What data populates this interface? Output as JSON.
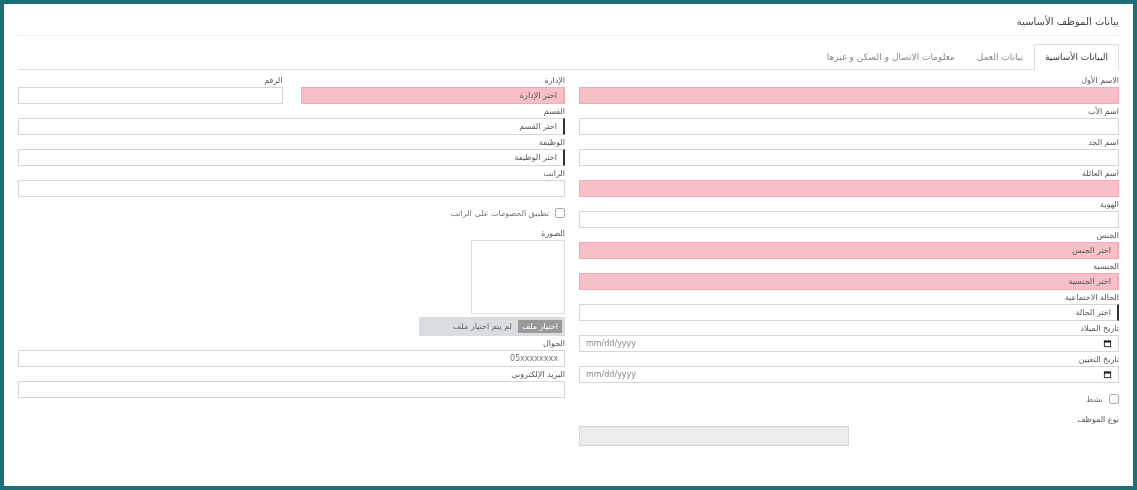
{
  "title": "بيانات الموظف الأساسية",
  "tabs": [
    {
      "label": "البيانات الأساسية",
      "selected": true
    },
    {
      "label": "بيانات العمل",
      "selected": false
    },
    {
      "label": "معلومات الاتصال و السكن و غيرها",
      "selected": false
    }
  ],
  "right_column": [
    {
      "kind": "text",
      "label": "الاسم الأول",
      "invalid": true
    },
    {
      "kind": "text",
      "label": "اسم الأب",
      "invalid": false
    },
    {
      "kind": "text",
      "label": "اسم الجد",
      "invalid": false
    },
    {
      "kind": "text",
      "label": "اسم العائلة",
      "invalid": true
    },
    {
      "kind": "text",
      "label": "الهوية",
      "invalid": false
    },
    {
      "kind": "select",
      "label": "الجنس",
      "value": "اختر الجنس",
      "invalid": true
    },
    {
      "kind": "select",
      "label": "الجنسية",
      "value": "اختر الجنسية",
      "invalid": true
    },
    {
      "kind": "select",
      "label": "الحالة الاجتماعية",
      "value": "اختر الحالة",
      "invalid": false
    },
    {
      "kind": "date",
      "label": "تاريخ الميلاد",
      "placeholder": "mm/dd/yyyy",
      "invalid": false
    },
    {
      "kind": "date",
      "label": "تاريخ التعيين",
      "placeholder": "mm/dd/yyyy",
      "invalid": false
    },
    {
      "kind": "checkbox",
      "label": "نشط",
      "checked": false
    },
    {
      "kind": "disabled",
      "label": "نوع الموظف"
    }
  ],
  "left_column": [
    {
      "kind": "pair",
      "items": [
        {
          "kind": "select",
          "label": "الإدارة",
          "value": "اختر الإدارة",
          "invalid": true
        },
        {
          "kind": "text",
          "label": "الرقم",
          "invalid": false
        }
      ]
    },
    {
      "kind": "select",
      "label": "القسم",
      "value": "اختر القسم",
      "invalid": false
    },
    {
      "kind": "select",
      "label": "الوظيفة",
      "value": "اختر الوظيفة",
      "invalid": false
    },
    {
      "kind": "text",
      "label": "الراتب",
      "invalid": false
    },
    {
      "kind": "checkbox",
      "label": "تطبيق الخصومات على الراتب",
      "checked": false
    },
    {
      "kind": "image",
      "label": "الصورة"
    },
    {
      "kind": "file",
      "button": "اختيار ملف",
      "status": "لم يتم اختيار ملف"
    },
    {
      "kind": "text",
      "label": "الجوال",
      "placeholder": "05xxxxxxxx",
      "invalid": false
    },
    {
      "kind": "text",
      "label": "البريد الإلكتروني",
      "invalid": false
    }
  ]
}
